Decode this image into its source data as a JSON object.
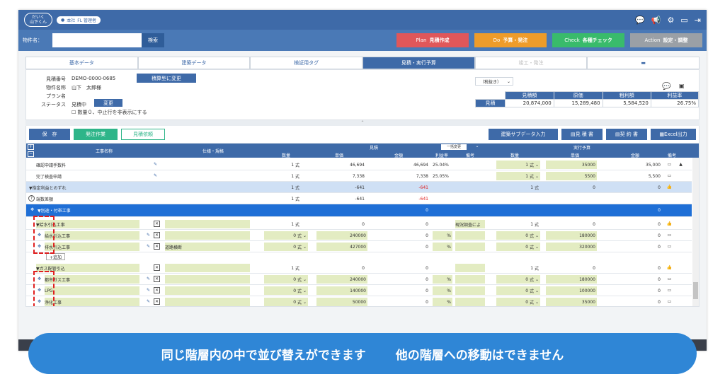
{
  "topbar": {
    "logo_text": "だいく\n山下くん",
    "user_role": "本社",
    "user_label": "FL 管理者"
  },
  "search": {
    "label": "物件名：",
    "value": "",
    "button": "検索"
  },
  "modes": [
    {
      "prefix": "Plan",
      "label": "見積作成",
      "color": "#e0575a"
    },
    {
      "prefix": "Do",
      "label": "予算・発注",
      "color": "#ee9c2a"
    },
    {
      "prefix": "Check",
      "label": "各種チェック",
      "color": "#39bb6b"
    },
    {
      "prefix": "Action",
      "label": "設定・調整",
      "color": "#9aa0a6"
    }
  ],
  "tabs": [
    "基本データ",
    "建築データ",
    "検証用タグ",
    "見積・実行予算",
    "竣工・発注",
    ""
  ],
  "info": {
    "quote_no_label": "見積番号",
    "quote_no": "DEMO-0000-0685",
    "convert_button": "積算型に変更",
    "customer_label": "物件名称",
    "customer": "山下　太郎様",
    "plan_label": "プラン名",
    "plan": "",
    "status_label": "ステータス",
    "status": "見積中",
    "status_button": "変更",
    "checkbox_label": "数量０、中止行を非表示にする",
    "tax_select": "（税抜き）"
  },
  "summary": {
    "headers": [
      "見積額",
      "原価",
      "粗利額",
      "利益率"
    ],
    "row_label": "見積",
    "values": [
      "20,874,000",
      "15,289,480",
      "5,584,520",
      "26.75%"
    ]
  },
  "toolbar": {
    "save": "保　存",
    "order": "発注作業",
    "request": "見積依頼",
    "sub_input": "建築サブデータ入力",
    "quote_doc": "見 積 書",
    "contract": "契 約 書",
    "excel": "Excel出力"
  },
  "grid": {
    "headers": {
      "name": "工事名称",
      "spec": "仕様・規格",
      "estimate_group": "見積",
      "bulk_change": "一括変更",
      "budget_group": "実行予算",
      "qty": "数量",
      "unit_price": "単価",
      "amount": "金額",
      "margin": "利益率",
      "note": "備考",
      "b_qty": "数量",
      "b_unit_price": "単価",
      "b_amount": "金額",
      "b_note": "備考"
    },
    "rows": [
      {
        "name": "確認申請手数料",
        "qty": "1",
        "unit": "式",
        "price": "46,694",
        "amount": "46,694",
        "margin": "25.04%",
        "bqty": "1",
        "bunit": "式",
        "bprice": "35000",
        "bamount": "35,000"
      },
      {
        "name": "完了検査申請",
        "qty": "1",
        "unit": "式",
        "price": "7,338",
        "amount": "7,338",
        "margin": "25.05%",
        "bqty": "1",
        "bunit": "式",
        "bprice": "5500",
        "bamount": "5,500"
      },
      {
        "name": "▼指定利益とのずれ",
        "qty": "1",
        "unit": "式",
        "price": "-641",
        "amount": "-641",
        "bqty": "1",
        "bunit": "式",
        "bprice": "0",
        "bamount": "0"
      },
      {
        "name": "端数差額",
        "qty": "1",
        "unit": "式",
        "price": "-641",
        "amount": "-641"
      },
      {
        "name": "▼別途・付帯工事",
        "amount": "0",
        "bamount": "0"
      },
      {
        "name": "▼給水引込工事",
        "qty": "1",
        "unit": "式",
        "price": "0",
        "amount": "0",
        "note": "現況調査によ",
        "bqty": "1",
        "bunit": "式",
        "bprice": "0",
        "bamount": "0"
      },
      {
        "name": "給水引込工事",
        "qty": "0",
        "unit": "式",
        "price": "240000",
        "amount": "0",
        "margin": "%",
        "bqty": "0",
        "bunit": "式",
        "bprice": "180000",
        "bamount": "0"
      },
      {
        "name": "排水引込工事",
        "spec": "道路横断",
        "qty": "0",
        "unit": "式",
        "price": "427000",
        "amount": "0",
        "margin": "%",
        "bqty": "0",
        "bunit": "式",
        "bprice": "320000",
        "bamount": "0"
      },
      {
        "name": "▼ガス配管引込",
        "qty": "1",
        "unit": "式",
        "price": "0",
        "amount": "0",
        "bqty": "1",
        "bunit": "式",
        "bprice": "0",
        "bamount": "0"
      },
      {
        "name": "都市ガス工事",
        "qty": "0",
        "unit": "式",
        "price": "240000",
        "amount": "0",
        "margin": "%",
        "bqty": "0",
        "bunit": "式",
        "bprice": "180000",
        "bamount": "0"
      },
      {
        "name": "LPG",
        "qty": "0",
        "unit": "式",
        "price": "140000",
        "amount": "0",
        "margin": "%",
        "bqty": "0",
        "bunit": "式",
        "bprice": "100000",
        "bamount": "0"
      },
      {
        "name": "浄化工事",
        "qty": "0",
        "unit": "式",
        "price": "50000",
        "amount": "0",
        "margin": "%",
        "bqty": "0",
        "bunit": "式",
        "bprice": "35000",
        "bamount": "0"
      }
    ],
    "add_label": "+追加"
  },
  "banner": {
    "left": "同じ階層内の中で並び替えができます",
    "right": "他の階層への移動はできません"
  },
  "colors": {
    "primary": "#3e6aa8",
    "highlight_red": "#e02020",
    "banner": "#2f86d6",
    "band": "#1f6fd6"
  }
}
